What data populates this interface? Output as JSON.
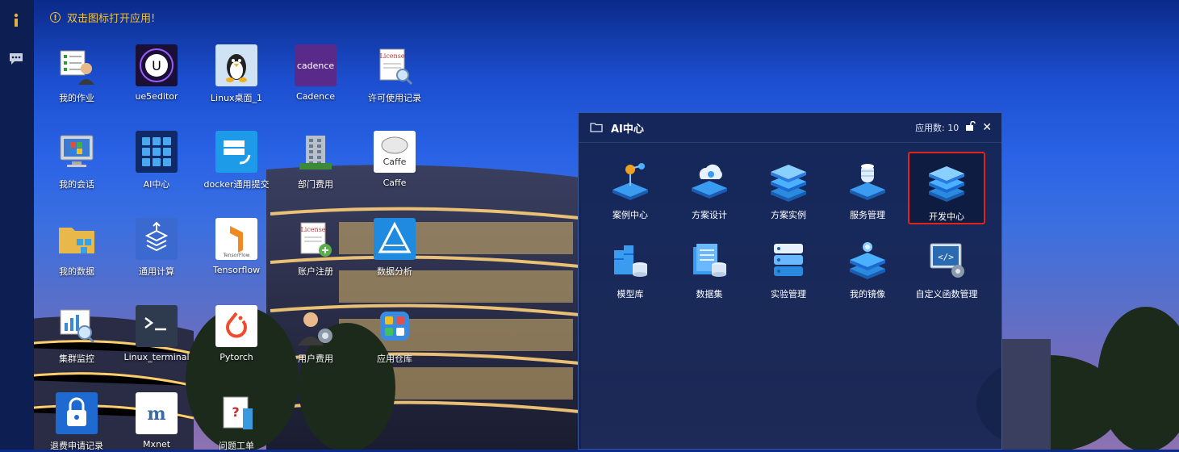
{
  "notice": {
    "text": "双击图标打开应用!"
  },
  "left_rail": {
    "icons": [
      "info-icon",
      "chat-icon"
    ]
  },
  "desktop_icons": [
    {
      "label": "我的作业",
      "icon": "user-jobs-icon"
    },
    {
      "label": "ue5editor",
      "icon": "unreal-icon"
    },
    {
      "label": "Linux桌面_1",
      "icon": "linux-penguin-icon"
    },
    {
      "label": "Cadence",
      "icon": "cadence-icon"
    },
    {
      "label": "许可使用记录",
      "icon": "license-icon"
    },
    {
      "label": "我的会话",
      "icon": "monitor-icon"
    },
    {
      "label": "AI中心",
      "icon": "ai-center-icon"
    },
    {
      "label": "docker通用提交",
      "icon": "docker-icon"
    },
    {
      "label": "部门费用",
      "icon": "building-icon"
    },
    {
      "label": "Caffe",
      "icon": "caffe-icon"
    },
    {
      "label": "我的数据",
      "icon": "folder-data-icon"
    },
    {
      "label": "通用计算",
      "icon": "compute-icon"
    },
    {
      "label": "Tensorflow",
      "icon": "tensorflow-icon"
    },
    {
      "label": "账户注册",
      "icon": "license-register-icon"
    },
    {
      "label": "数据分析",
      "icon": "data-analysis-icon"
    },
    {
      "label": "集群监控",
      "icon": "cluster-monitor-icon"
    },
    {
      "label": "Linux_terminal",
      "icon": "terminal-icon"
    },
    {
      "label": "Pytorch",
      "icon": "pytorch-icon"
    },
    {
      "label": "用户费用",
      "icon": "user-cost-icon"
    },
    {
      "label": "应用仓库",
      "icon": "app-store-icon"
    },
    {
      "label": "退费申请记录",
      "icon": "refund-icon"
    },
    {
      "label": "Mxnet",
      "icon": "mxnet-icon"
    },
    {
      "label": "问题工单",
      "icon": "ticket-icon"
    }
  ],
  "window": {
    "title": "AI中心",
    "count_label": "应用数: 10",
    "apps": [
      {
        "label": "案例中心",
        "icon": "case-center-icon"
      },
      {
        "label": "方案设计",
        "icon": "solution-design-icon"
      },
      {
        "label": "方案实例",
        "icon": "solution-instance-icon"
      },
      {
        "label": "服务管理",
        "icon": "service-management-icon"
      },
      {
        "label": "开发中心",
        "icon": "dev-center-icon",
        "selected": true
      },
      {
        "label": "模型库",
        "icon": "model-library-icon"
      },
      {
        "label": "数据集",
        "icon": "dataset-icon"
      },
      {
        "label": "实验管理",
        "icon": "experiment-management-icon"
      },
      {
        "label": "我的镜像",
        "icon": "my-image-icon"
      },
      {
        "label": "自定义函数管理",
        "icon": "custom-function-icon"
      }
    ]
  },
  "colors": {
    "notice": "#f0c23a",
    "selected_border": "#e0241a",
    "accent_blue": "#2b8ff0"
  }
}
